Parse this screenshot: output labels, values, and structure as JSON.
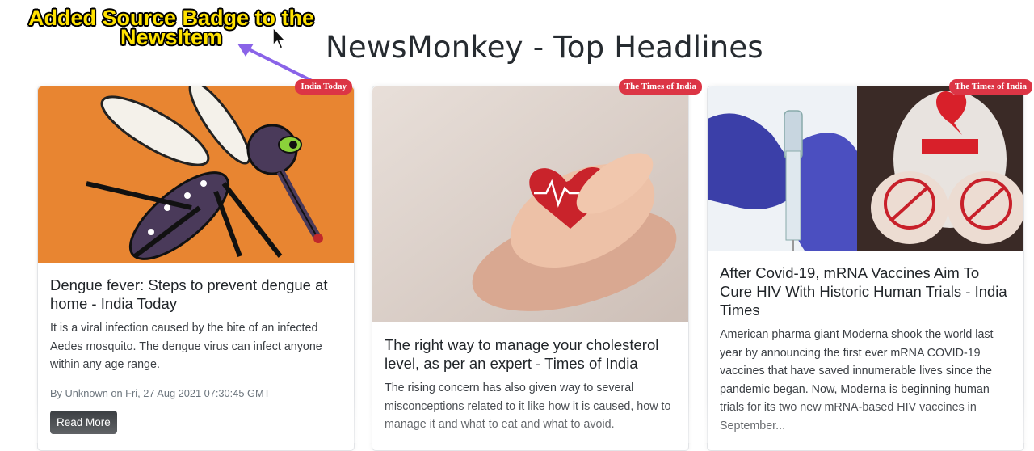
{
  "header": {
    "title": "NewsMonkey - Top Headlines"
  },
  "annotation": {
    "line1": "Added Source Badge to the",
    "line2": "NewsItem"
  },
  "colors": {
    "badge": "#dc3545",
    "button": "#212529",
    "annotation_text": "#ffe200",
    "arrow": "#8a63e8"
  },
  "news": [
    {
      "source": "India Today",
      "image": "mosquito-illustration",
      "title": "Dengue fever: Steps to prevent dengue at home - India Today",
      "description": "It is a viral infection caused by the bite of an infected Aedes mosquito. The dengue virus can infect anyone within any age range.",
      "meta": "By Unknown on Fri, 27 Aug 2021 07:30:45 GMT",
      "button": "Read More"
    },
    {
      "source": "The Times of India",
      "image": "hands-holding-heart",
      "title": "The right way to manage your cholesterol level, as per an expert - Times of India",
      "description": "The rising concern has also given way to several misconceptions related to it like how it is caused, how to manage it and what to eat and what to avoid."
    },
    {
      "source": "The Times of India",
      "image": "vaccine-hiv-aids",
      "title": "After Covid-19, mRNA Vaccines Aim To Cure HIV With Historic Human Trials - India Times",
      "description": "American pharma giant Moderna shook the world last year by announcing the first ever mRNA COVID-19 vaccines that have saved innumerable lives since the pandemic began. Now, Moderna is beginning human trials for its two new mRNA-based HIV vaccines in September..."
    }
  ]
}
